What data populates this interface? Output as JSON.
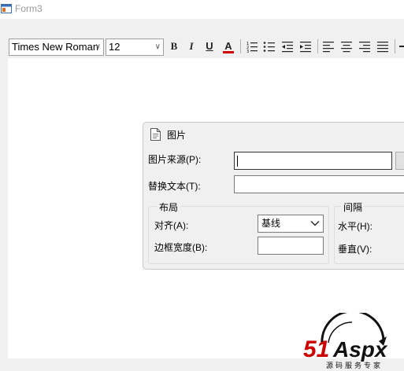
{
  "window": {
    "title": "Form3"
  },
  "toolbar": {
    "font_family": "Times New Roman",
    "font_size": "12",
    "bold_label": "B",
    "italic_label": "I",
    "underline_label": "U",
    "font_color_label": "A",
    "font_color": "#d00000"
  },
  "dialog": {
    "title": "图片",
    "source_label": "图片来源(P):",
    "source_value": "",
    "alt_label": "替换文本(T):",
    "alt_value": "",
    "layout_group": "布局",
    "align_label": "对齐(A):",
    "align_value": "基线",
    "border_label": "边框宽度(B):",
    "border_value": "",
    "spacing_group": "间隔",
    "horizontal_label": "水平(H):",
    "vertical_label": "垂直(V):"
  },
  "watermark": {
    "brand": "51Aspx",
    "tagline": "源码服务专家"
  }
}
